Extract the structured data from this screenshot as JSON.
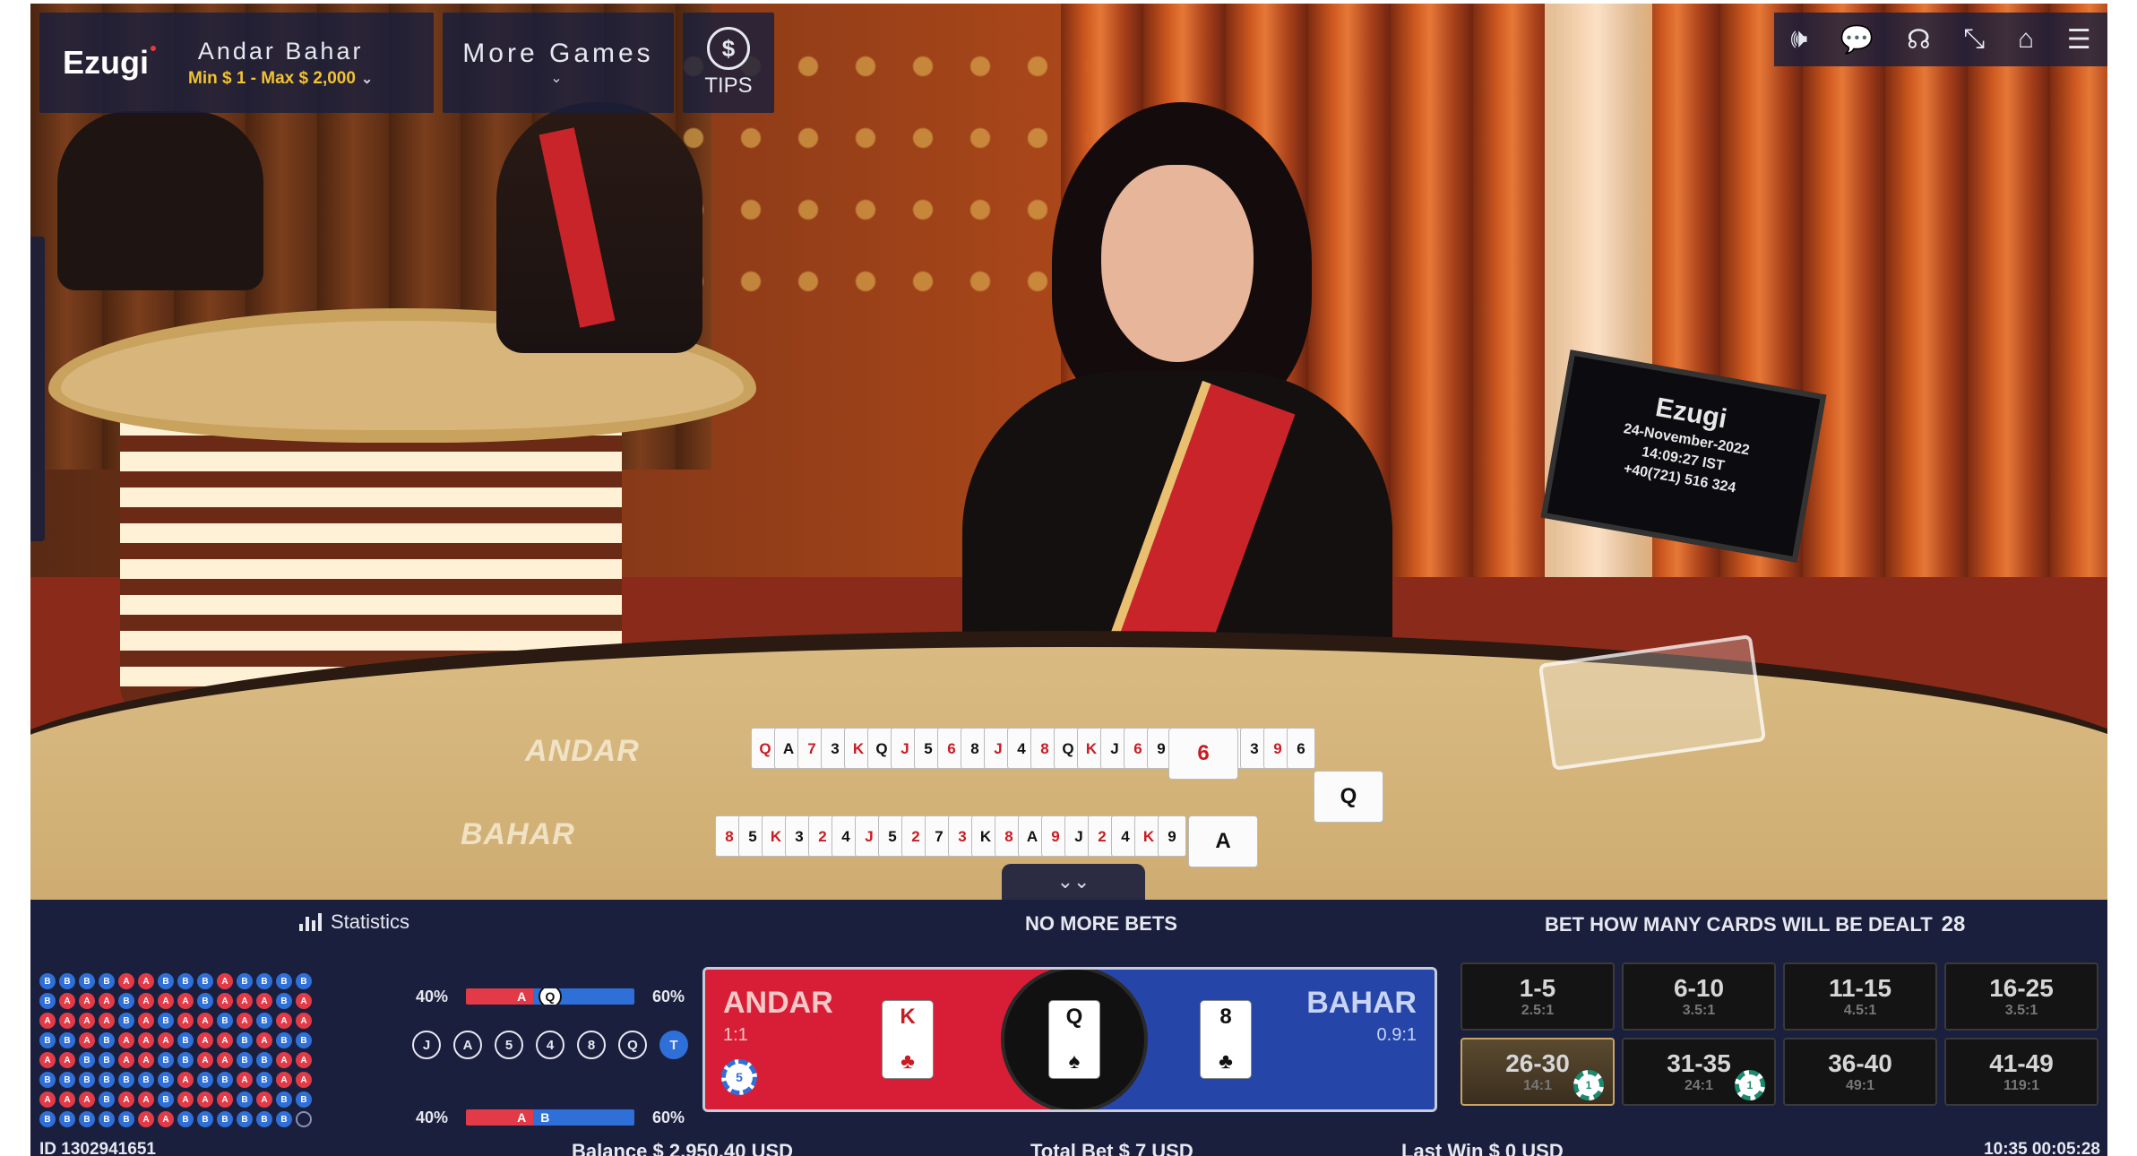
{
  "header": {
    "brand": "Ezugi",
    "game_title": "Andar Bahar",
    "limits": "Min $ 1 - Max $ 2,000",
    "more_games": "More Games",
    "tips_symbol": "$",
    "tips_label": "TIPS"
  },
  "top_icons": [
    "speaker-icon",
    "chat-icon",
    "headset-icon",
    "collapse-icon",
    "home-icon",
    "menu-icon"
  ],
  "scene": {
    "monitor_brand": "Ezugi",
    "monitor_date": "24-November-2022",
    "monitor_time": "14:09:27 IST",
    "monitor_phone": "+40(721) 516 324",
    "andar_label": "ANDAR",
    "bahar_label": "BAHAR",
    "andar_row_cards": [
      "Q",
      "A",
      "7",
      "3",
      "K",
      "Q",
      "J",
      "5",
      "6",
      "8",
      "J",
      "4",
      "8",
      "Q",
      "K",
      "J",
      "6",
      "9",
      "4",
      "8",
      "5",
      "3",
      "9",
      "6"
    ],
    "bahar_row_cards": [
      "8",
      "5",
      "K",
      "3",
      "2",
      "4",
      "J",
      "5",
      "2",
      "7",
      "3",
      "K",
      "8",
      "A",
      "9",
      "J",
      "2",
      "4",
      "K",
      "9"
    ],
    "andar_last_card": "6",
    "bahar_last_card": "A",
    "joker_table_card": "Q"
  },
  "panel": {
    "statistics_label": "Statistics",
    "status": "NO MORE BETS",
    "bet_cards_label": "BET HOW MANY CARDS WILL BE DEALT",
    "bet_cards_value": "28",
    "bead_road": [
      "B",
      "B",
      "B",
      "B",
      "A",
      "A",
      "B",
      "B",
      "B",
      "A",
      "B",
      "B",
      "B",
      "B",
      "B",
      "A",
      "A",
      "A",
      "B",
      "A",
      "A",
      "A",
      "B",
      "A",
      "A",
      "A",
      "B",
      "A",
      "A",
      "A",
      "A",
      "A",
      "B",
      "A",
      "B",
      "A",
      "A",
      "B",
      "A",
      "B",
      "A",
      "A",
      "B",
      "B",
      "A",
      "B",
      "A",
      "A",
      "A",
      "B",
      "A",
      "A",
      "B",
      "A",
      "B",
      "B",
      "A",
      "A",
      "B",
      "B",
      "A",
      "A",
      "B",
      "B",
      "A",
      "A",
      "B",
      "B",
      "A",
      "A",
      "B",
      "B",
      "B",
      "B",
      "B",
      "B",
      "B",
      "A",
      "B",
      "B",
      "A",
      "B",
      "A",
      "A",
      "A",
      "A",
      "A",
      "B",
      "A",
      "A",
      "B",
      "A",
      "A",
      "A",
      "B",
      "A",
      "B",
      "B",
      "B",
      "B",
      "B",
      "B",
      "B",
      "A",
      "A",
      "B",
      "B",
      "B",
      "B",
      "B",
      "B",
      "E"
    ],
    "pct_top": {
      "left": "40%",
      "right": "60%",
      "a": "A",
      "b": "B",
      "badge": "Q",
      "a_share": 40
    },
    "pct_bottom": {
      "left": "40%",
      "right": "60%",
      "a": "A",
      "b": "B",
      "a_share": 40
    },
    "rank_chips": [
      "J",
      "A",
      "5",
      "4",
      "8",
      "Q",
      "T"
    ],
    "andar": {
      "title": "ANDAR",
      "odds": "1:1",
      "chip": "5",
      "card_rank": "K",
      "card_suit": "♣"
    },
    "bahar": {
      "title": "BAHAR",
      "odds": "0.9:1",
      "card_rank": "8",
      "card_suit": "♣"
    },
    "joker": {
      "rank": "Q",
      "suit": "♠"
    },
    "side_bets": [
      {
        "range": "1-5",
        "odds": "2.5:1",
        "selected": false,
        "chip": ""
      },
      {
        "range": "6-10",
        "odds": "3.5:1",
        "selected": false,
        "chip": ""
      },
      {
        "range": "11-15",
        "odds": "4.5:1",
        "selected": false,
        "chip": ""
      },
      {
        "range": "16-25",
        "odds": "3.5:1",
        "selected": false,
        "chip": ""
      },
      {
        "range": "26-30",
        "odds": "14:1",
        "selected": true,
        "chip": "1"
      },
      {
        "range": "31-35",
        "odds": "24:1",
        "selected": false,
        "chip": "1"
      },
      {
        "range": "36-40",
        "odds": "49:1",
        "selected": false,
        "chip": ""
      },
      {
        "range": "41-49",
        "odds": "119:1",
        "selected": false,
        "chip": ""
      }
    ]
  },
  "footer": {
    "id": "ID 1302941651",
    "balance": "Balance  $ 2,950.40 USD",
    "total_bet": "Total Bet $ 7 USD",
    "last_win": "Last Win $ 0 USD",
    "time": "10:35  00:05:28"
  },
  "colors": {
    "andar": "#d81e36",
    "bahar": "#2546a8",
    "panel_bg": "#1b1f3e",
    "limits": "#f2c230"
  }
}
